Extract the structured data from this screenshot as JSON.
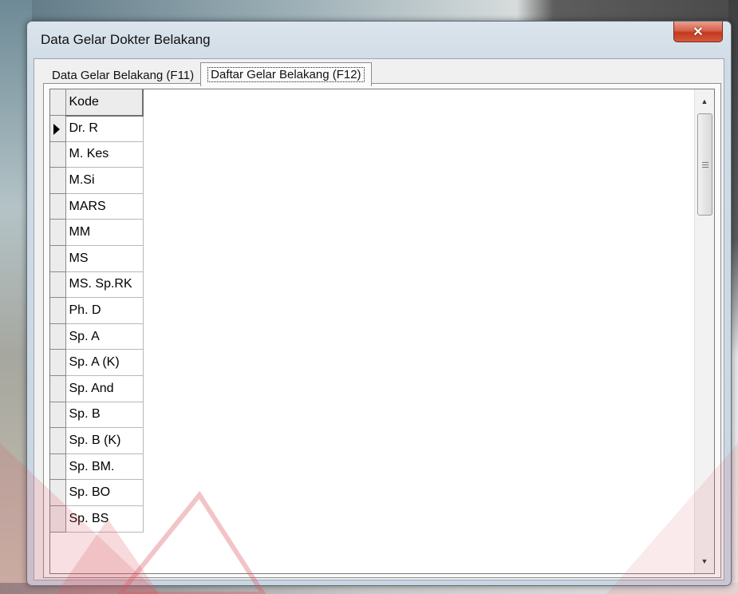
{
  "window": {
    "title": "Data Gelar Dokter Belakang",
    "close_glyph": "✕"
  },
  "tabs": [
    {
      "label": "Data Gelar Belakang (F11)",
      "active": false
    },
    {
      "label": "Daftar Gelar Belakang (F12)",
      "active": true
    }
  ],
  "grid": {
    "column_header": "Kode",
    "current_row_index": 0,
    "rows": [
      "Dr. R",
      "M. Kes",
      "M.Si",
      "MARS",
      "MM",
      "MS",
      "MS. Sp.RK",
      "Ph. D",
      "Sp. A",
      "Sp. A (K)",
      "Sp. And",
      "Sp. B",
      "Sp. B (K)",
      "Sp. BM.",
      "Sp. BO",
      "Sp. BS"
    ]
  },
  "scrollbar": {
    "up_icon": "▲",
    "down_icon": "▼"
  },
  "colors": {
    "close_button": "#c9452b",
    "watermark": "#d9555f"
  }
}
